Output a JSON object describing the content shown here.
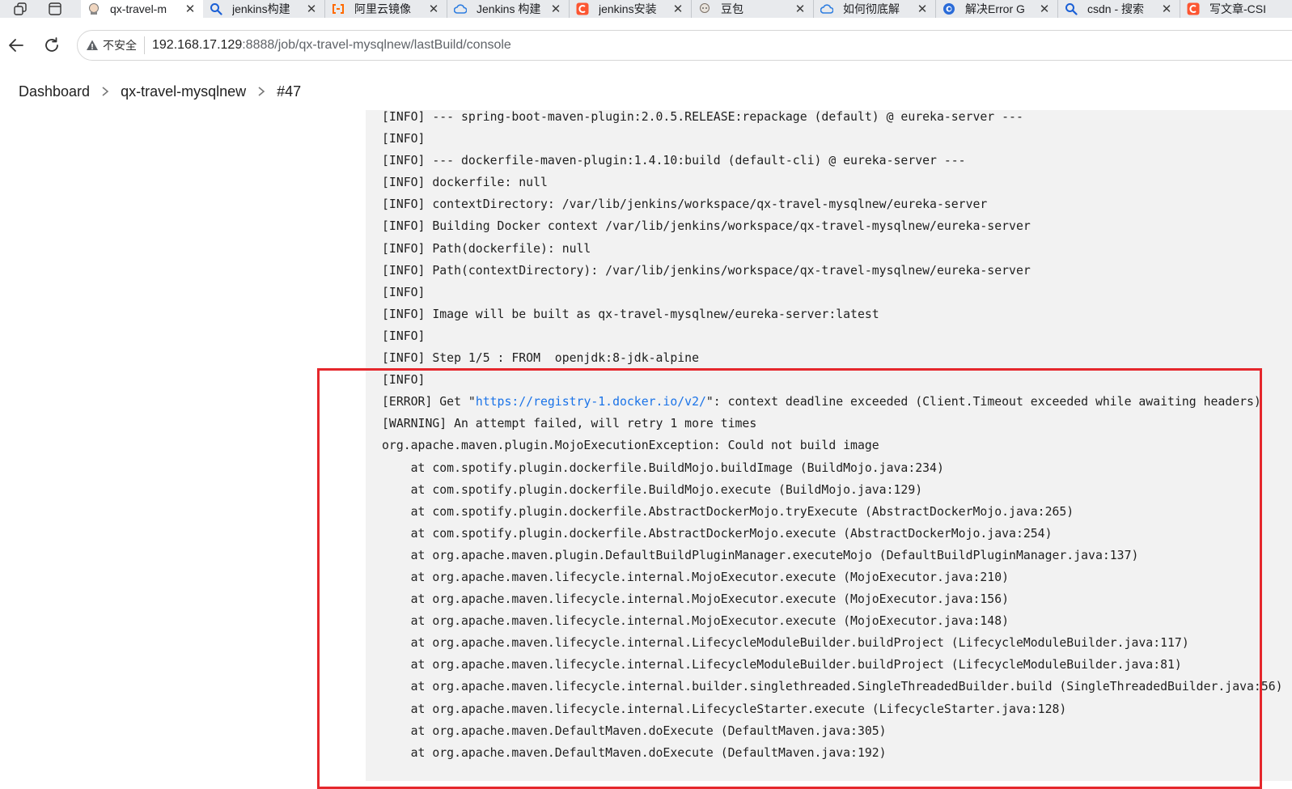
{
  "browser": {
    "tabs": [
      {
        "title": "qx-travel-m",
        "icon": "jenkins-icon",
        "active": true
      },
      {
        "title": "jenkins构建",
        "icon": "search-icon",
        "active": false
      },
      {
        "title": "阿里云镜像",
        "icon": "aliyun-icon",
        "active": false
      },
      {
        "title": "Jenkins 构建",
        "icon": "cloud-icon",
        "active": false
      },
      {
        "title": "jenkins安装",
        "icon": "csdn-icon",
        "active": false
      },
      {
        "title": "豆包",
        "icon": "doubao-icon",
        "active": false
      },
      {
        "title": "如何彻底解",
        "icon": "cloud-icon",
        "active": false
      },
      {
        "title": "解决Error G",
        "icon": "edge-icon",
        "active": false
      },
      {
        "title": "csdn - 搜索",
        "icon": "search-icon",
        "active": false
      },
      {
        "title": "写文章-CSI",
        "icon": "csdn-icon",
        "active": false
      }
    ],
    "security_label": "不安全",
    "url_host": "192.168.17.129",
    "url_rest": ":8888/job/qx-travel-mysqlnew/lastBuild/console"
  },
  "breadcrumb": {
    "dashboard": "Dashboard",
    "job": "qx-travel-mysqlnew",
    "build": "#47"
  },
  "console": {
    "lines": [
      "[INFO] --- spring-boot-maven-plugin:2.0.5.RELEASE:repackage (default) @ eureka-server ---",
      "[INFO]",
      "[INFO] --- dockerfile-maven-plugin:1.4.10:build (default-cli) @ eureka-server ---",
      "[INFO] dockerfile: null",
      "[INFO] contextDirectory: /var/lib/jenkins/workspace/qx-travel-mysqlnew/eureka-server",
      "[INFO] Building Docker context /var/lib/jenkins/workspace/qx-travel-mysqlnew/eureka-server",
      "[INFO] Path(dockerfile): null",
      "[INFO] Path(contextDirectory): /var/lib/jenkins/workspace/qx-travel-mysqlnew/eureka-server",
      "[INFO]",
      "[INFO] Image will be built as qx-travel-mysqlnew/eureka-server:latest",
      "[INFO]",
      "[INFO] Step 1/5 : FROM  openjdk:8-jdk-alpine",
      "[INFO]"
    ],
    "error_prefix": "[ERROR] Get \"",
    "error_link": "https://registry-1.docker.io/v2/",
    "error_suffix": "\": context deadline exceeded (Client.Timeout exceeded while awaiting headers)",
    "lines_after": [
      "[WARNING] An attempt failed, will retry 1 more times",
      "org.apache.maven.plugin.MojoExecutionException: Could not build image",
      "    at com.spotify.plugin.dockerfile.BuildMojo.buildImage (BuildMojo.java:234)",
      "    at com.spotify.plugin.dockerfile.BuildMojo.execute (BuildMojo.java:129)",
      "    at com.spotify.plugin.dockerfile.AbstractDockerMojo.tryExecute (AbstractDockerMojo.java:265)",
      "    at com.spotify.plugin.dockerfile.AbstractDockerMojo.execute (AbstractDockerMojo.java:254)",
      "    at org.apache.maven.plugin.DefaultBuildPluginManager.executeMojo (DefaultBuildPluginManager.java:137)",
      "    at org.apache.maven.lifecycle.internal.MojoExecutor.execute (MojoExecutor.java:210)",
      "    at org.apache.maven.lifecycle.internal.MojoExecutor.execute (MojoExecutor.java:156)",
      "    at org.apache.maven.lifecycle.internal.MojoExecutor.execute (MojoExecutor.java:148)",
      "    at org.apache.maven.lifecycle.internal.LifecycleModuleBuilder.buildProject (LifecycleModuleBuilder.java:117)",
      "    at org.apache.maven.lifecycle.internal.LifecycleModuleBuilder.buildProject (LifecycleModuleBuilder.java:81)",
      "    at org.apache.maven.lifecycle.internal.builder.singlethreaded.SingleThreadedBuilder.build (SingleThreadedBuilder.java:56)",
      "    at org.apache.maven.lifecycle.internal.LifecycleStarter.execute (LifecycleStarter.java:128)",
      "    at org.apache.maven.DefaultMaven.doExecute (DefaultMaven.java:305)",
      "    at org.apache.maven.DefaultMaven.doExecute (DefaultMaven.java:192)"
    ]
  },
  "colors": {
    "highlight_box": "#e5272c",
    "console_bg": "#f2f2f2",
    "link": "#1a73e8"
  }
}
